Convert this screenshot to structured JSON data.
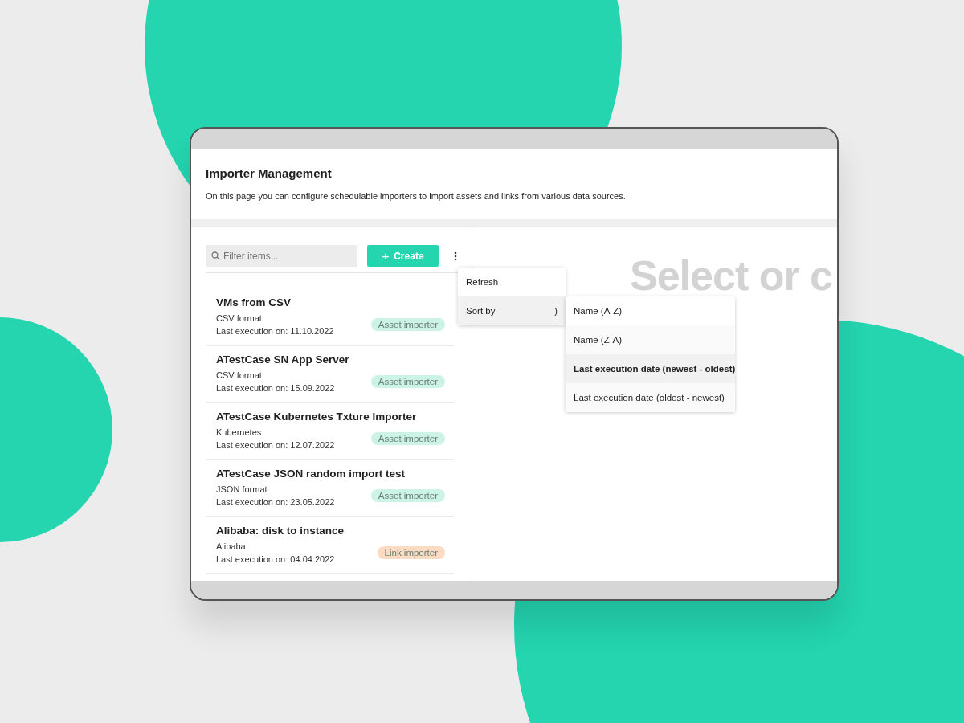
{
  "page": {
    "title": "Importer Management",
    "description": "On this page you can configure schedulable importers to import assets and links from various data sources."
  },
  "toolbar": {
    "filter": {
      "placeholder": "Filter items..."
    },
    "create_button": {
      "icon": "+",
      "label": "Create"
    }
  },
  "items": [
    {
      "name": "VMs from CSV",
      "source": "CSV format",
      "last_execution": "Last execution on: 11.10.2022",
      "badge": {
        "label": "Asset importer",
        "color": "#cdf3e7"
      }
    },
    {
      "name": "ATestCase SN App Server",
      "source": "CSV format",
      "last_execution": "Last execution on: 15.09.2022",
      "badge": {
        "label": "Asset importer",
        "color": "#cdf3e7"
      }
    },
    {
      "name": "ATestCase Kubernetes Txture Importer",
      "source": "Kubernetes",
      "last_execution": "Last execution on: 12.07.2022",
      "badge": {
        "label": "Asset importer",
        "color": "#cdf3e7"
      }
    },
    {
      "name": "ATestCase JSON random import test",
      "source": "JSON format",
      "last_execution": "Last execution on: 23.05.2022",
      "badge": {
        "label": "Asset importer",
        "color": "#cdf3e7"
      }
    },
    {
      "name": "Alibaba: disk to instance",
      "source": "Alibaba",
      "last_execution": "Last execution on: 04.04.2022",
      "badge": {
        "label": "Link importer",
        "color": "#fbdcc3"
      }
    }
  ],
  "menu": {
    "items": [
      {
        "label": "Refresh",
        "kind": "action",
        "expanded": false
      },
      {
        "label": "Sort by",
        "kind": "submenu",
        "arrow": ")",
        "expanded": true
      }
    ],
    "submenu": [
      {
        "label": "Name (A-Z)",
        "selected": false
      },
      {
        "label": "Name (Z-A)",
        "selected": false
      },
      {
        "label": "Last execution date (newest - oldest)",
        "selected": true
      },
      {
        "label": "Last execution date (oldest - newest)",
        "selected": false
      }
    ]
  },
  "detail": {
    "placeholder_heading": "Select or c"
  }
}
